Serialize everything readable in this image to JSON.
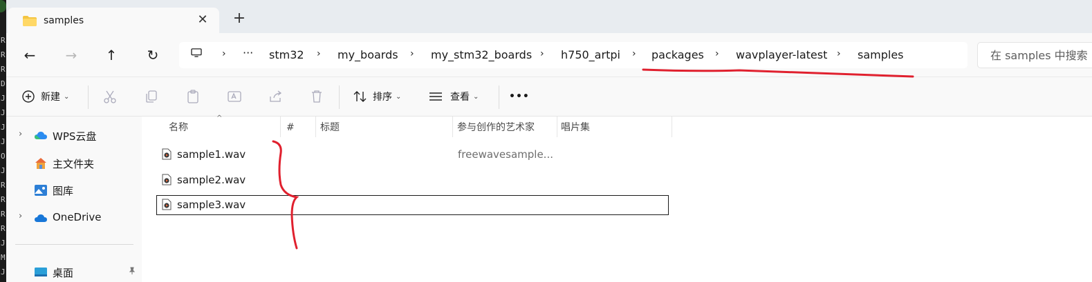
{
  "window": {
    "tab_title": "samples",
    "close_glyph": "✕",
    "new_tab_glyph": "+"
  },
  "nav": {
    "back_glyph": "←",
    "forward_glyph": "→",
    "up_glyph": "↑",
    "refresh_glyph": "↻"
  },
  "address": {
    "more_glyph": "···",
    "separator": "›",
    "crumbs": [
      "stm32",
      "my_boards",
      "my_stm32_boards",
      "h750_artpi",
      "packages",
      "wavplayer-latest",
      "samples"
    ]
  },
  "search": {
    "placeholder": "在 samples 中搜索"
  },
  "toolbar": {
    "new_label": "新建",
    "sort_label": "排序",
    "view_label": "查看",
    "more_glyph": "•••",
    "caret_glyph": "⌄"
  },
  "sidebar": {
    "items": [
      {
        "label": "WPS云盘",
        "icon": "cloud-icon",
        "expand": "›"
      },
      {
        "label": "主文件夹",
        "icon": "home-icon",
        "expand": ""
      },
      {
        "label": "图库",
        "icon": "gallery-icon",
        "expand": ""
      },
      {
        "label": "OneDrive",
        "icon": "onedrive-icon",
        "expand": "›"
      },
      {
        "label": "桌面",
        "icon": "desktop-icon",
        "expand": ""
      }
    ]
  },
  "columns": {
    "name": "名称",
    "number": "#",
    "title": "标题",
    "artist": "参与创作的艺术家",
    "album": "唱片集",
    "sort_glyph": "^"
  },
  "files": [
    {
      "name": "sample1.wav",
      "artist": "freewavesample..."
    },
    {
      "name": "sample2.wav",
      "artist": ""
    },
    {
      "name": "sample3.wav",
      "artist": ""
    }
  ],
  "left_strip_glyphs": [
    "R",
    "R",
    "R",
    "D",
    "J",
    "J",
    "J",
    "J",
    "O",
    "J",
    "R",
    "R",
    "R",
    "R",
    "J",
    "M",
    "J"
  ],
  "colors": {
    "titlebar": "#e8ecf0",
    "pane": "#f9f9f9",
    "annotation": "#e0202e",
    "folder": "#f4c542"
  }
}
